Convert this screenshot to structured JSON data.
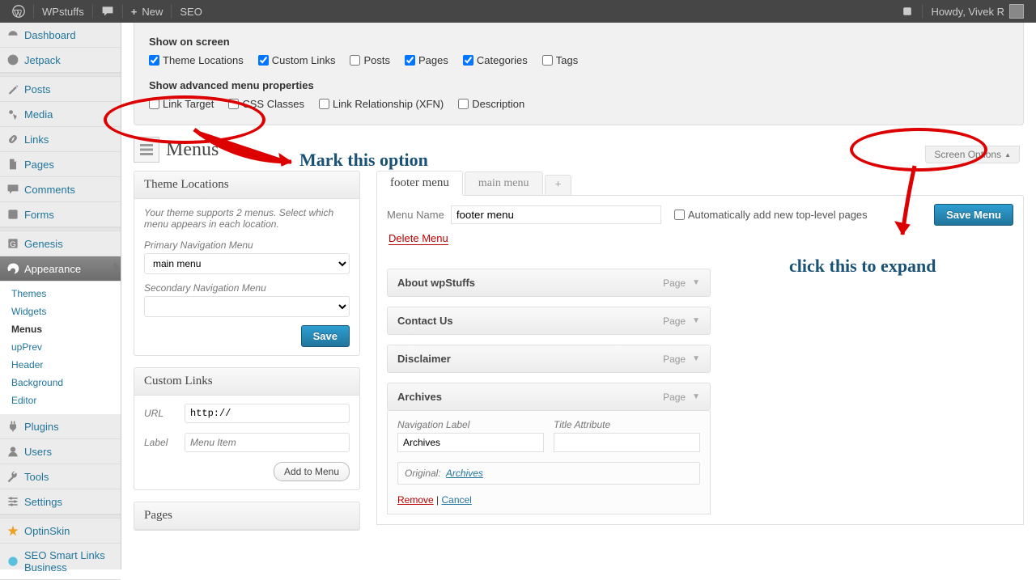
{
  "adminbar": {
    "site": "WPstuffs",
    "new": "New",
    "seo": "SEO",
    "howdy": "Howdy, Vivek R"
  },
  "sidebar": {
    "items": [
      {
        "label": "Dashboard",
        "icon": "dashboard"
      },
      {
        "label": "Jetpack",
        "icon": "jetpack"
      },
      {
        "label": "Posts",
        "icon": "posts",
        "sep_before": true
      },
      {
        "label": "Media",
        "icon": "media"
      },
      {
        "label": "Links",
        "icon": "links"
      },
      {
        "label": "Pages",
        "icon": "pages"
      },
      {
        "label": "Comments",
        "icon": "comments"
      },
      {
        "label": "Forms",
        "icon": "forms"
      },
      {
        "label": "Genesis",
        "icon": "genesis",
        "sep_before": true
      },
      {
        "label": "Appearance",
        "icon": "appearance",
        "current": true
      },
      {
        "label": "Plugins",
        "icon": "plugins"
      },
      {
        "label": "Users",
        "icon": "users"
      },
      {
        "label": "Tools",
        "icon": "tools"
      },
      {
        "label": "Settings",
        "icon": "settings"
      },
      {
        "label": "OptinSkin",
        "icon": "optinskin",
        "sep_before": true
      },
      {
        "label": "SEO Smart Links Business",
        "icon": "seosmart"
      }
    ],
    "submenu": [
      {
        "label": "Themes"
      },
      {
        "label": "Widgets"
      },
      {
        "label": "Menus",
        "current": true
      },
      {
        "label": "upPrev"
      },
      {
        "label": "Header"
      },
      {
        "label": "Background"
      },
      {
        "label": "Editor"
      }
    ]
  },
  "screen_meta": {
    "show_on_screen": "Show on screen",
    "row1": [
      {
        "label": "Theme Locations",
        "checked": true
      },
      {
        "label": "Custom Links",
        "checked": true
      },
      {
        "label": "Posts",
        "checked": false
      },
      {
        "label": "Pages",
        "checked": true
      },
      {
        "label": "Categories",
        "checked": true
      },
      {
        "label": "Tags",
        "checked": false
      }
    ],
    "show_adv": "Show advanced menu properties",
    "row2": [
      {
        "label": "Link Target",
        "checked": false
      },
      {
        "label": "CSS Classes",
        "checked": false
      },
      {
        "label": "Link Relationship (XFN)",
        "checked": false
      },
      {
        "label": "Description",
        "checked": false
      }
    ]
  },
  "screen_options_tab": "Screen Options",
  "heading": "Menus",
  "theme_locations": {
    "title": "Theme Locations",
    "desc": "Your theme supports 2 menus. Select which menu appears in each location.",
    "primary_label": "Primary Navigation Menu",
    "primary_value": "main menu",
    "secondary_label": "Secondary Navigation Menu",
    "secondary_value": "",
    "save": "Save"
  },
  "custom_links": {
    "title": "Custom Links",
    "url_label": "URL",
    "url_value": "http://",
    "label_label": "Label",
    "label_placeholder": "Menu Item",
    "add": "Add to Menu"
  },
  "pages_box": {
    "title": "Pages"
  },
  "menu_tabs": [
    {
      "label": "footer menu",
      "active": true
    },
    {
      "label": "main menu",
      "active": false
    }
  ],
  "menu_tab_add": "+",
  "menu_settings": {
    "name_label": "Menu Name",
    "name_value": "footer menu",
    "auto_add": "Automatically add new top-level pages",
    "delete": "Delete Menu",
    "save": "Save Menu"
  },
  "menu_items": [
    {
      "title": "About wpStuffs",
      "type": "Page",
      "open": false
    },
    {
      "title": "Contact Us",
      "type": "Page",
      "open": false
    },
    {
      "title": "Disclaimer",
      "type": "Page",
      "open": false
    },
    {
      "title": "Archives",
      "type": "Page",
      "open": true,
      "nav_label_label": "Navigation Label",
      "nav_label_value": "Archives",
      "title_attr_label": "Title Attribute",
      "title_attr_value": "",
      "original_label": "Original:",
      "original_link": "Archives",
      "remove": "Remove",
      "cancel": "Cancel"
    }
  ],
  "annotations": {
    "mark_option": "Mark this option",
    "click_expand": "click this to expand"
  }
}
